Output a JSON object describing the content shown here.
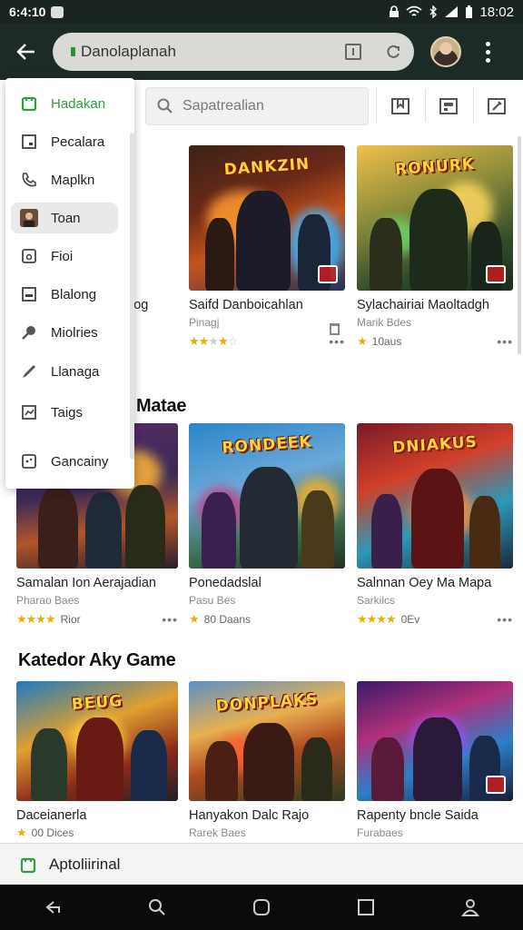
{
  "status_bar": {
    "time_left": "6:4:10",
    "time_right": "18:02"
  },
  "app_bar": {
    "url": "Danolaplanah"
  },
  "search": {
    "placeholder": "Sapatrealian"
  },
  "drawer": {
    "items": [
      {
        "label": "Hadakan",
        "icon": "store-icon"
      },
      {
        "label": "Pecalara",
        "icon": "tablet-icon"
      },
      {
        "label": "Maplkn",
        "icon": "phone-icon"
      },
      {
        "label": "Toan",
        "icon": "avatar-icon"
      },
      {
        "label": "Fioi",
        "icon": "file-icon"
      },
      {
        "label": "Blalong",
        "icon": "window-icon"
      },
      {
        "label": "Miolries",
        "icon": "pin-icon"
      },
      {
        "label": "Llanaga",
        "icon": "pen-icon"
      },
      {
        "label": "Taigs",
        "icon": "chart-icon"
      },
      {
        "label": "Gancainy",
        "icon": "gamepad-icon"
      }
    ]
  },
  "rows": [
    {
      "title": "",
      "cards": [
        {
          "title": "iog",
          "sub": "",
          "rating_text": "",
          "stars": 0,
          "logo": ""
        },
        {
          "title": "Saifd Danboicahlan",
          "sub": "Pinagj",
          "rating_text": "",
          "stars": 3,
          "logo": "DANKZIN"
        },
        {
          "title": "Sylachairiai Maoltadgh",
          "sub": "Marik Bdes",
          "rating_text": "10aus",
          "stars": 1,
          "logo": "RONURK"
        }
      ]
    },
    {
      "title": "Matae",
      "cards": [
        {
          "title": "Samalan Ion Aerajadian",
          "sub": "Pharao Baes",
          "rating_text": "Rior",
          "stars": 4,
          "logo": ""
        },
        {
          "title": "Ponedadslal",
          "sub": "Pasu Bes",
          "rating_text": "80 Daans",
          "stars": 1,
          "logo": "RONDEEK"
        },
        {
          "title": "Salnnan Oey Ma Mapa",
          "sub": "Sarkilcs",
          "rating_text": "0Ev",
          "stars": 4,
          "logo": "DNIAKUS"
        }
      ]
    },
    {
      "title": "Katedor Aky Game",
      "cards": [
        {
          "title": "Daceianerla",
          "sub": "00 Dices",
          "rating_text": "",
          "stars": 1,
          "logo": "BEUG"
        },
        {
          "title": "Hanyakon Dalc Rajo",
          "sub": "Rarek Baes",
          "rating_text": "",
          "stars": 0,
          "logo": "DONPLAKS"
        },
        {
          "title": "Rapenty bncle Saida",
          "sub": "Furabaes",
          "rating_text": "",
          "stars": 0,
          "logo": ""
        }
      ]
    }
  ],
  "bottom_strip": {
    "label": "Aptoliirinal"
  },
  "colors": {
    "app_bar": "#1d2b26",
    "accent_green": "#2e9e3e",
    "star": "#e8b000"
  }
}
